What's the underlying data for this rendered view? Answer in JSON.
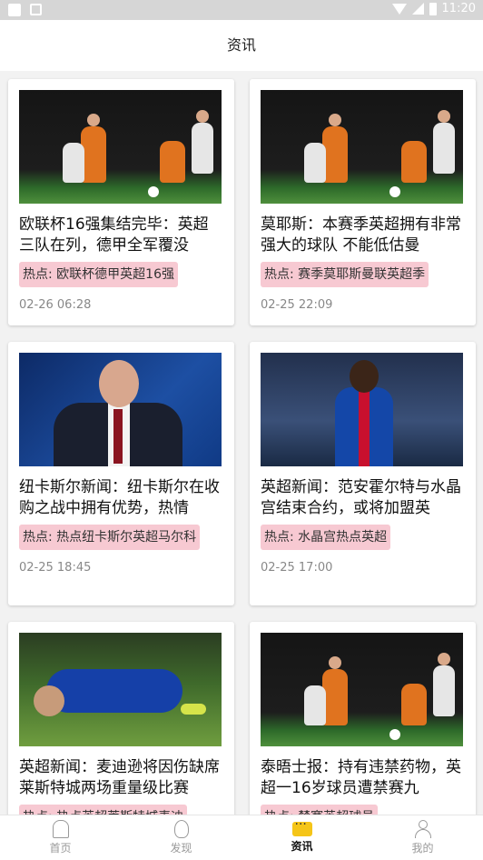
{
  "status_bar": {
    "time": "11:20"
  },
  "header": {
    "title": "资讯"
  },
  "cards": [
    {
      "title": "欧联杯16强集结完毕：英超三队在列，德甲全军覆没",
      "tag": "热点: 欧联杯德甲英超16强",
      "time": "02-26 06:28",
      "image": "football-match"
    },
    {
      "title": "莫耶斯：本赛季英超拥有非常强大的球队 不能低估曼",
      "tag": "热点: 赛季莫耶斯曼联英超季",
      "time": "02-25 22:09",
      "image": "football-match"
    },
    {
      "title": "纽卡斯尔新闻：纽卡斯尔在收购之战中拥有优势，热情",
      "tag": "热点: 热点纽卡斯尔英超马尔科",
      "time": "02-25 18:45",
      "image": "man-in-suit"
    },
    {
      "title": "英超新闻：范安霍尔特与水晶宫结束合约，或将加盟英",
      "tag": "热点: 水晶宫热点英超",
      "time": "02-25 17:00",
      "image": "crystal-palace-player"
    },
    {
      "title": "英超新闻：麦迪逊将因伤缺席莱斯特城两场重量级比赛",
      "tag": "热点: 热点英超莱斯特城麦迪",
      "time": "",
      "image": "injured-player"
    },
    {
      "title": "泰晤士报：持有违禁药物，英超一16岁球员遭禁赛九",
      "tag": "热点: 禁赛英超球员",
      "time": "",
      "image": "football-match"
    }
  ],
  "tabbar": {
    "tabs": [
      {
        "label": "首页",
        "icon": "home-icon"
      },
      {
        "label": "发现",
        "icon": "lightbulb-icon"
      },
      {
        "label": "资讯",
        "icon": "news-icon",
        "active": true
      },
      {
        "label": "我的",
        "icon": "user-icon"
      }
    ]
  }
}
